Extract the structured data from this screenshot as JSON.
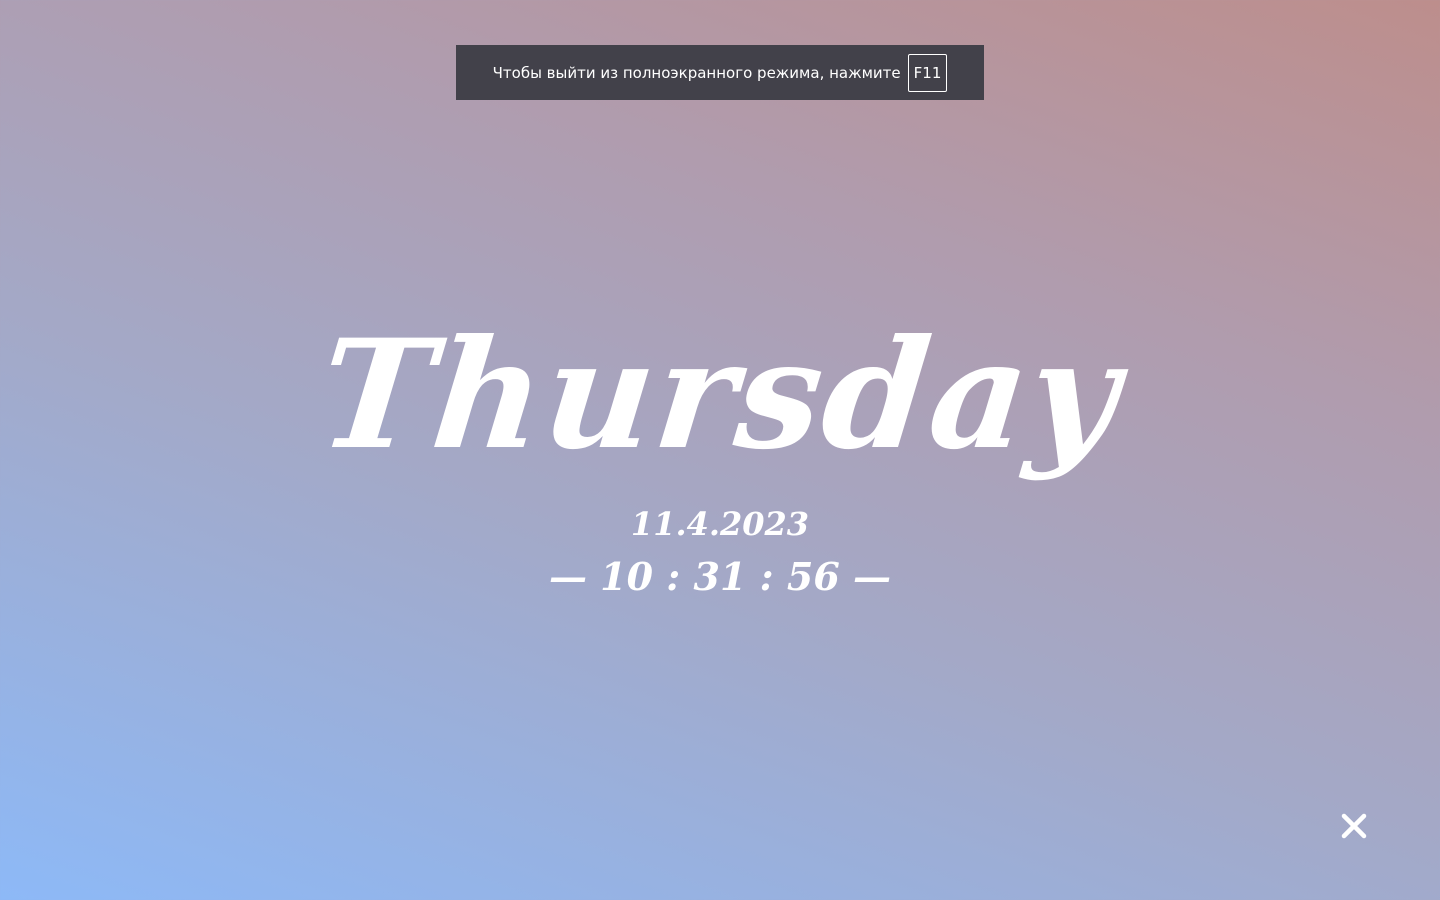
{
  "fullscreen_notice": {
    "message": "Чтобы выйти из полноэкранного режима, нажмите",
    "key": "F11"
  },
  "clock": {
    "day": "Thursday",
    "date": "11.4.2023",
    "time": "— 10 : 31 : 56 —"
  },
  "controls": {
    "close_icon": "close-icon"
  },
  "colors": {
    "toast_background": "#42414a",
    "text": "#ffffff",
    "gradient_top_right": "#bd8e8c",
    "gradient_bottom_left": "#8db9f7"
  }
}
